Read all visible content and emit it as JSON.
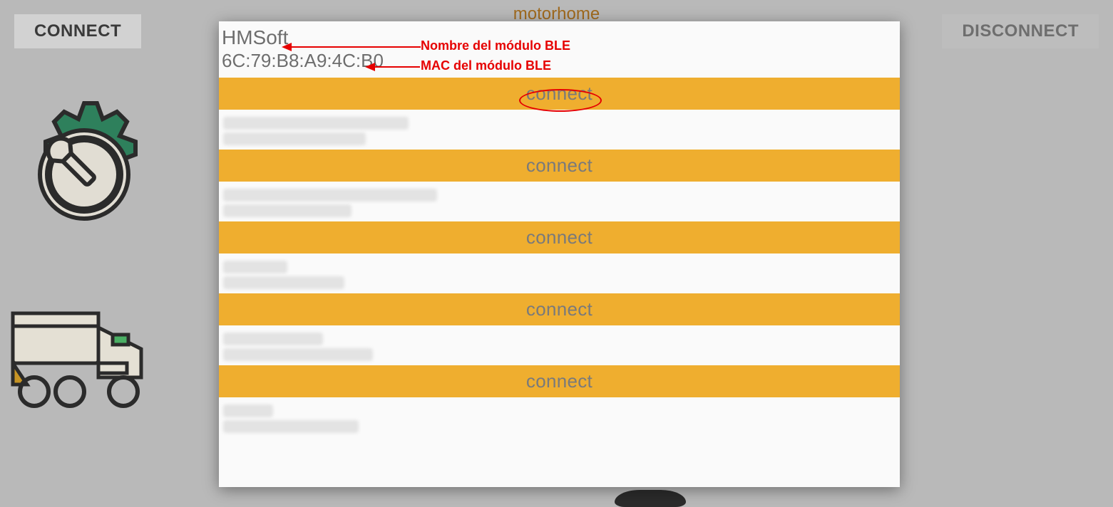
{
  "app": {
    "title": "motorhome"
  },
  "header": {
    "connect_label": "CONNECT",
    "disconnect_label": "DISCONNECT"
  },
  "modal": {
    "devices": [
      {
        "name": "HMSoft",
        "mac": "6C:79:B8:A9:4C:B0",
        "button": "connect"
      },
      {
        "name": "",
        "mac": "",
        "button": "connect"
      },
      {
        "name": "",
        "mac": "",
        "button": "connect"
      },
      {
        "name": "",
        "mac": "",
        "button": "connect"
      },
      {
        "name": "",
        "mac": "",
        "button": "connect"
      },
      {
        "name": "",
        "mac": "",
        "button": ""
      }
    ]
  },
  "annotations": {
    "name_label": "Nombre del módulo BLE",
    "mac_label": "MAC del módulo BLE"
  },
  "icons": {
    "gear": "gear-wrench-icon",
    "motorhome": "motorhome-icon"
  }
}
